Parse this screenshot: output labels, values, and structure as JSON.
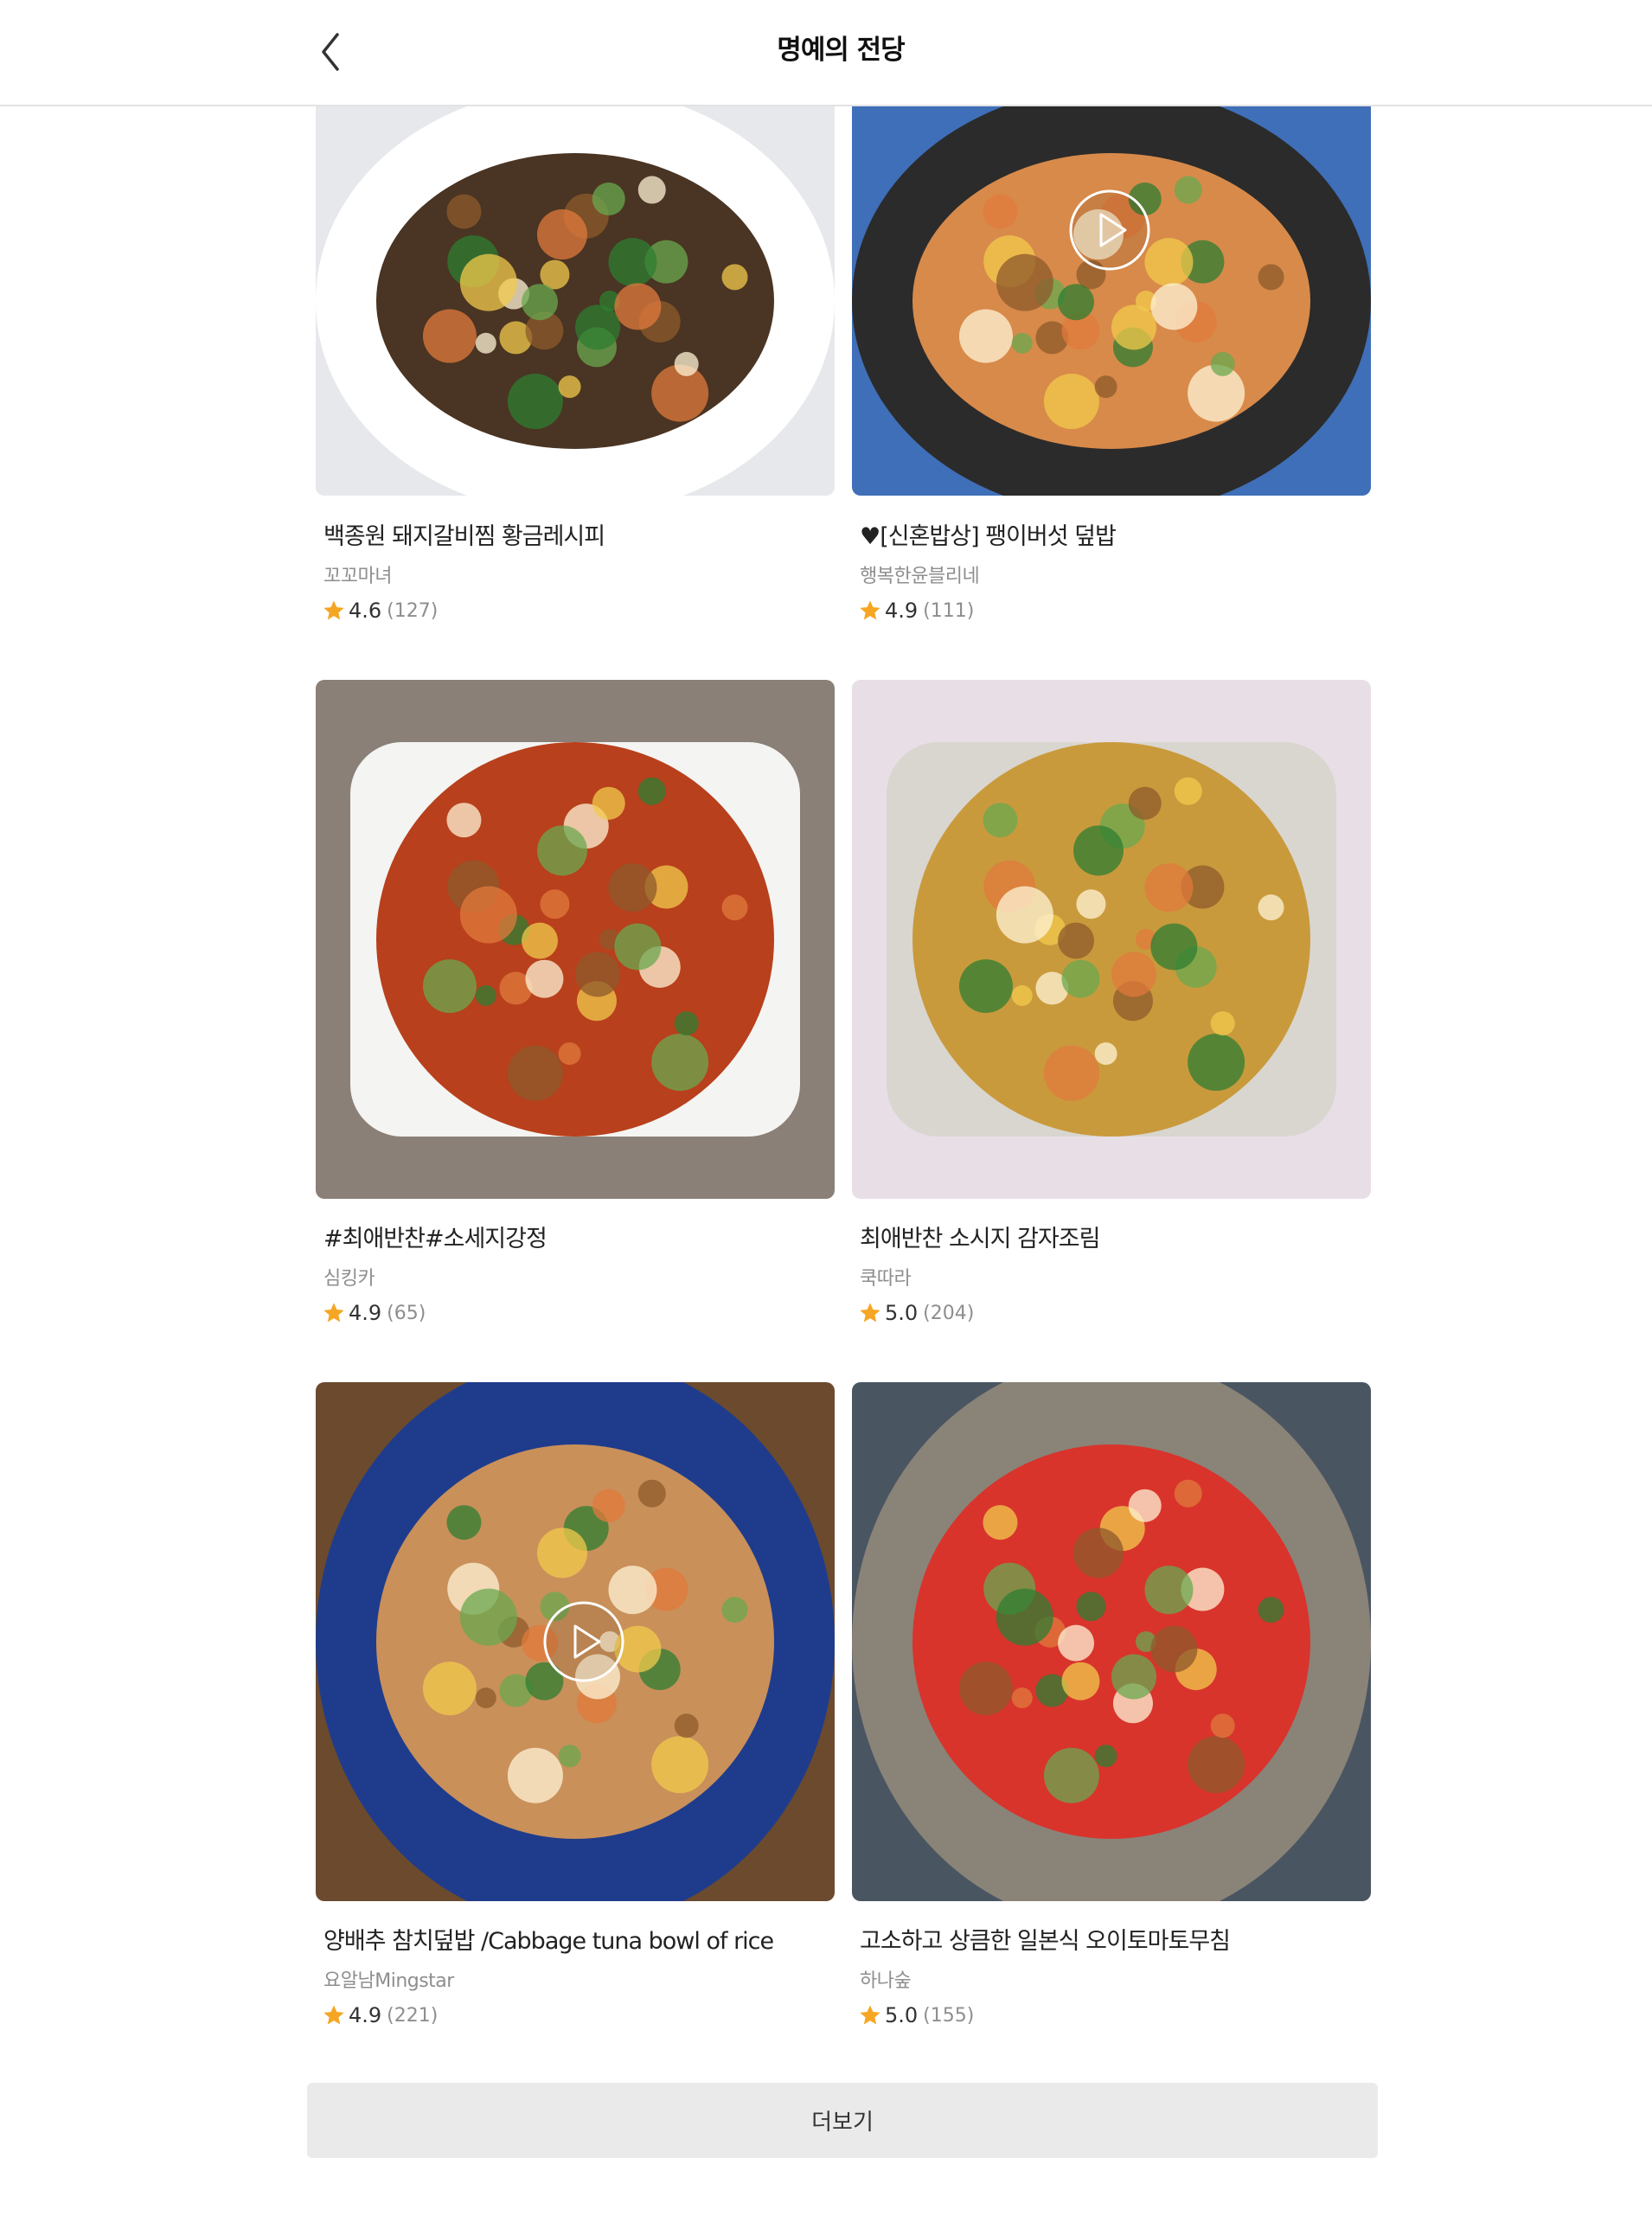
{
  "header": {
    "title": "명예의 전당",
    "back_icon": "chevron-left-icon"
  },
  "cards": [
    {
      "title": "백종원 돼지갈비찜 황금레시피",
      "author": "꼬꼬마녀",
      "rating": "4.6",
      "reviews": "(127)",
      "has_video": false,
      "plate_color": "#ffffff",
      "bg_color": "#e6e8ec",
      "food_color": "#4a3423"
    },
    {
      "title": "♥[신혼밥상] 팽이버섯 덮밥",
      "author": "행복한윤블리네",
      "rating": "4.9",
      "reviews": "(111)",
      "has_video": true,
      "plate_color": "#2b2b2b",
      "bg_color": "#3f6fb8",
      "food_color": "#d88a4a"
    },
    {
      "title": "#최애반찬#소세지강정",
      "author": "심킹카",
      "rating": "4.9",
      "reviews": "(65)",
      "has_video": false,
      "plate_color": "#f4f4f2",
      "bg_color": "#8a8078",
      "food_color": "#b8401c"
    },
    {
      "title": "최애반찬 소시지 감자조림",
      "author": "쿡따라",
      "rating": "5.0",
      "reviews": "(204)",
      "has_video": false,
      "plate_color": "#d9d6d0",
      "bg_color": "#e8dfe6",
      "food_color": "#c99a3c"
    },
    {
      "title": "양배추 참치덮밥 /Cabbage tuna bowl of rice",
      "author": "요알남Mingstar",
      "rating": "4.9",
      "reviews": "(221)",
      "has_video": true,
      "plate_color": "#1f3c8c",
      "bg_color": "#6b4a2e",
      "food_color": "#c9905a"
    },
    {
      "title": "고소하고 상큼한 일본식 오이토마토무침",
      "author": "하나숲",
      "rating": "5.0",
      "reviews": "(155)",
      "has_video": false,
      "plate_color": "#8a8378",
      "bg_color": "#4a5562",
      "food_color": "#d8342c"
    }
  ],
  "more_button": {
    "label": "더보기"
  },
  "colors": {
    "star": "#f5a623",
    "more_button_bg": "#eaeaea"
  },
  "icons": {
    "rating": "star-icon",
    "video": "play-icon"
  }
}
